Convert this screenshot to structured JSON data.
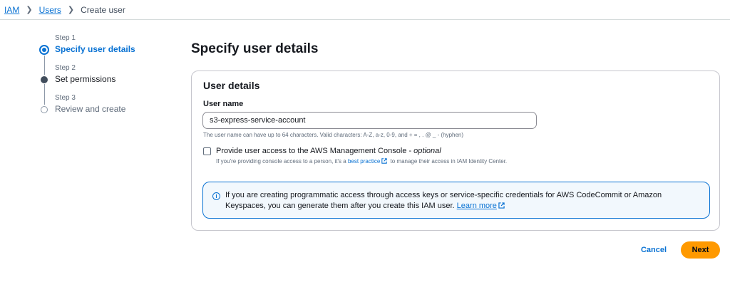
{
  "breadcrumb": {
    "items": [
      {
        "label": "IAM"
      },
      {
        "label": "Users"
      },
      {
        "label": "Create user"
      }
    ]
  },
  "steps": [
    {
      "number": "Step 1",
      "name": "Specify user details",
      "state": "active"
    },
    {
      "number": "Step 2",
      "name": "Set permissions",
      "state": "done"
    },
    {
      "number": "Step 3",
      "name": "Review and create",
      "state": "future"
    }
  ],
  "page_title": "Specify user details",
  "user_details": {
    "title": "User details",
    "user_name_label": "User name",
    "user_name_value": "s3-express-service-account",
    "constraint_text": "The user name can have up to 64 characters. Valid characters: A-Z, a-z, 0-9, and + = , . @ _ - (hyphen)",
    "console_access": {
      "label": "Provide user access to the AWS Management Console - ",
      "label_optional": "optional",
      "checked": false,
      "desc_prefix": "If you're providing console access to a person, it's a ",
      "desc_link": "best practice",
      "desc_suffix": " to manage their access in IAM Identity Center."
    },
    "info_alert": {
      "text": "If you are creating programmatic access through access keys or service-specific credentials for AWS CodeCommit or Amazon Keyspaces, you can generate them after you create this IAM user. ",
      "link": "Learn more"
    }
  },
  "actions": {
    "cancel_label": "Cancel",
    "next_label": "Next"
  },
  "colors": {
    "link": "#0972d3",
    "primary_button": "#ff9900",
    "info_background": "#f2f8fd"
  }
}
